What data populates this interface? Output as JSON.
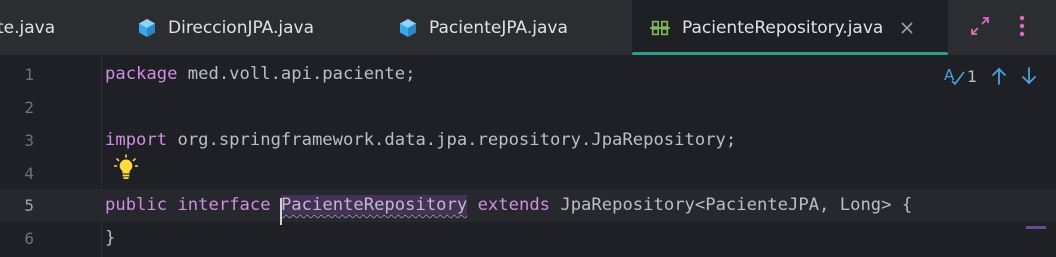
{
  "tabs": [
    {
      "label": "te.java",
      "active": false
    },
    {
      "label": "DireccionJPA.java",
      "active": false
    },
    {
      "label": "PacienteJPA.java",
      "active": false
    },
    {
      "label": "PacienteRepository.java",
      "active": true
    }
  ],
  "colors": {
    "accent": "#2a9d8f",
    "keyword": "#cf8ee0",
    "class_icon": "#3aa8e8",
    "interface_icon": "#7fb95a",
    "bulb": "#ffd93d",
    "tool_icon": "#d86dc0",
    "nav_arrow": "#4aa3df"
  },
  "inspection": {
    "count": "1"
  },
  "editor": {
    "lines": [
      {
        "n": "1",
        "kw1": "package",
        "rest": " med.voll.api.paciente;"
      },
      {
        "n": "2"
      },
      {
        "n": "3",
        "kw1": "import",
        "rest": " org.springframework.data.jpa.repository.JpaRepository;"
      },
      {
        "n": "4"
      },
      {
        "n": "5",
        "kw1": "public",
        "sp1": " ",
        "kw2": "interface",
        "sp2": " ",
        "selected": "PacienteRepository",
        "sp3": " ",
        "kw3": "extends",
        "rest": " JpaRepository<PacienteJPA, Long> {"
      },
      {
        "n": "6",
        "rest": "}"
      }
    ]
  }
}
